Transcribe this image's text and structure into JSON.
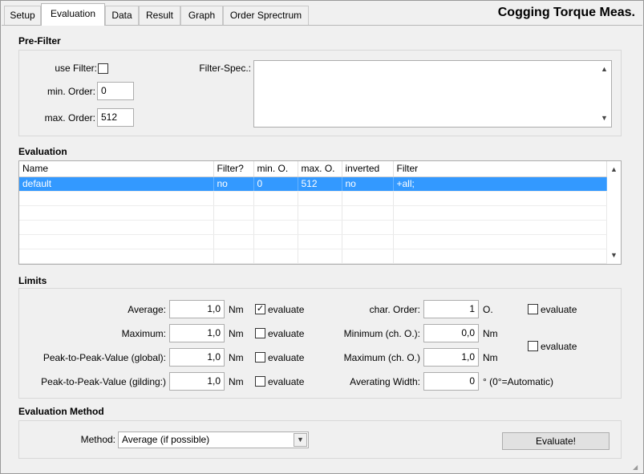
{
  "app_title": "Cogging Torque Meas.",
  "tabs": [
    {
      "label": "Setup"
    },
    {
      "label": "Evaluation",
      "active": true
    },
    {
      "label": "Data"
    },
    {
      "label": "Result"
    },
    {
      "label": "Graph"
    },
    {
      "label": "Order Sprectrum"
    }
  ],
  "prefilter": {
    "title": "Pre-Filter",
    "use_filter_label": "use Filter:",
    "use_filter_checked": false,
    "min_order_label": "min. Order:",
    "min_order_value": "0",
    "max_order_label": "max. Order:",
    "max_order_value": "512",
    "filter_spec_label": "Filter-Spec.:",
    "filter_spec_value": ""
  },
  "evaluation": {
    "title": "Evaluation",
    "columns": [
      "Name",
      "Filter?",
      "min. O.",
      "max. O.",
      "inverted",
      "Filter"
    ],
    "rows": [
      {
        "name": "default",
        "filter": "no",
        "min_o": "0",
        "max_o": "512",
        "inverted": "no",
        "filter_expr": "+all;",
        "selected": true
      }
    ]
  },
  "limits": {
    "title": "Limits",
    "average_label": "Average:",
    "average_value": "1,0",
    "average_unit": "Nm",
    "average_evaluate": true,
    "maximum_label": "Maximum:",
    "maximum_value": "1,0",
    "maximum_unit": "Nm",
    "maximum_evaluate": false,
    "ptp_global_label": "Peak-to-Peak-Value (global):",
    "ptp_global_value": "1,0",
    "ptp_global_unit": "Nm",
    "ptp_global_evaluate": false,
    "ptp_gilding_label": "Peak-to-Peak-Value (gilding:)",
    "ptp_gilding_value": "1,0",
    "ptp_gilding_unit": "Nm",
    "ptp_gilding_evaluate": false,
    "evaluate_label": "evaluate",
    "char_order_label": "char. Order:",
    "char_order_value": "1",
    "char_order_unit": "O.",
    "char_order_evaluate": false,
    "min_ch_label": "Minimum (ch. O.):",
    "min_ch_value": "0,0",
    "min_ch_unit": "Nm",
    "max_ch_label": "Maximum (ch. O.)",
    "max_ch_value": "1,0",
    "max_ch_unit": "Nm",
    "minmax_ch_evaluate": false,
    "avg_width_label": "Averating Width:",
    "avg_width_value": "0",
    "avg_width_unit": "° (0°=Automatic)"
  },
  "method": {
    "title": "Evaluation Method",
    "label": "Method:",
    "selected": "Average (if possible)",
    "evaluate_button": "Evaluate!"
  },
  "icons": {
    "check_glyph": "✓",
    "up_glyph": "▲",
    "down_glyph": "▼",
    "dropdown_glyph": "▼"
  }
}
